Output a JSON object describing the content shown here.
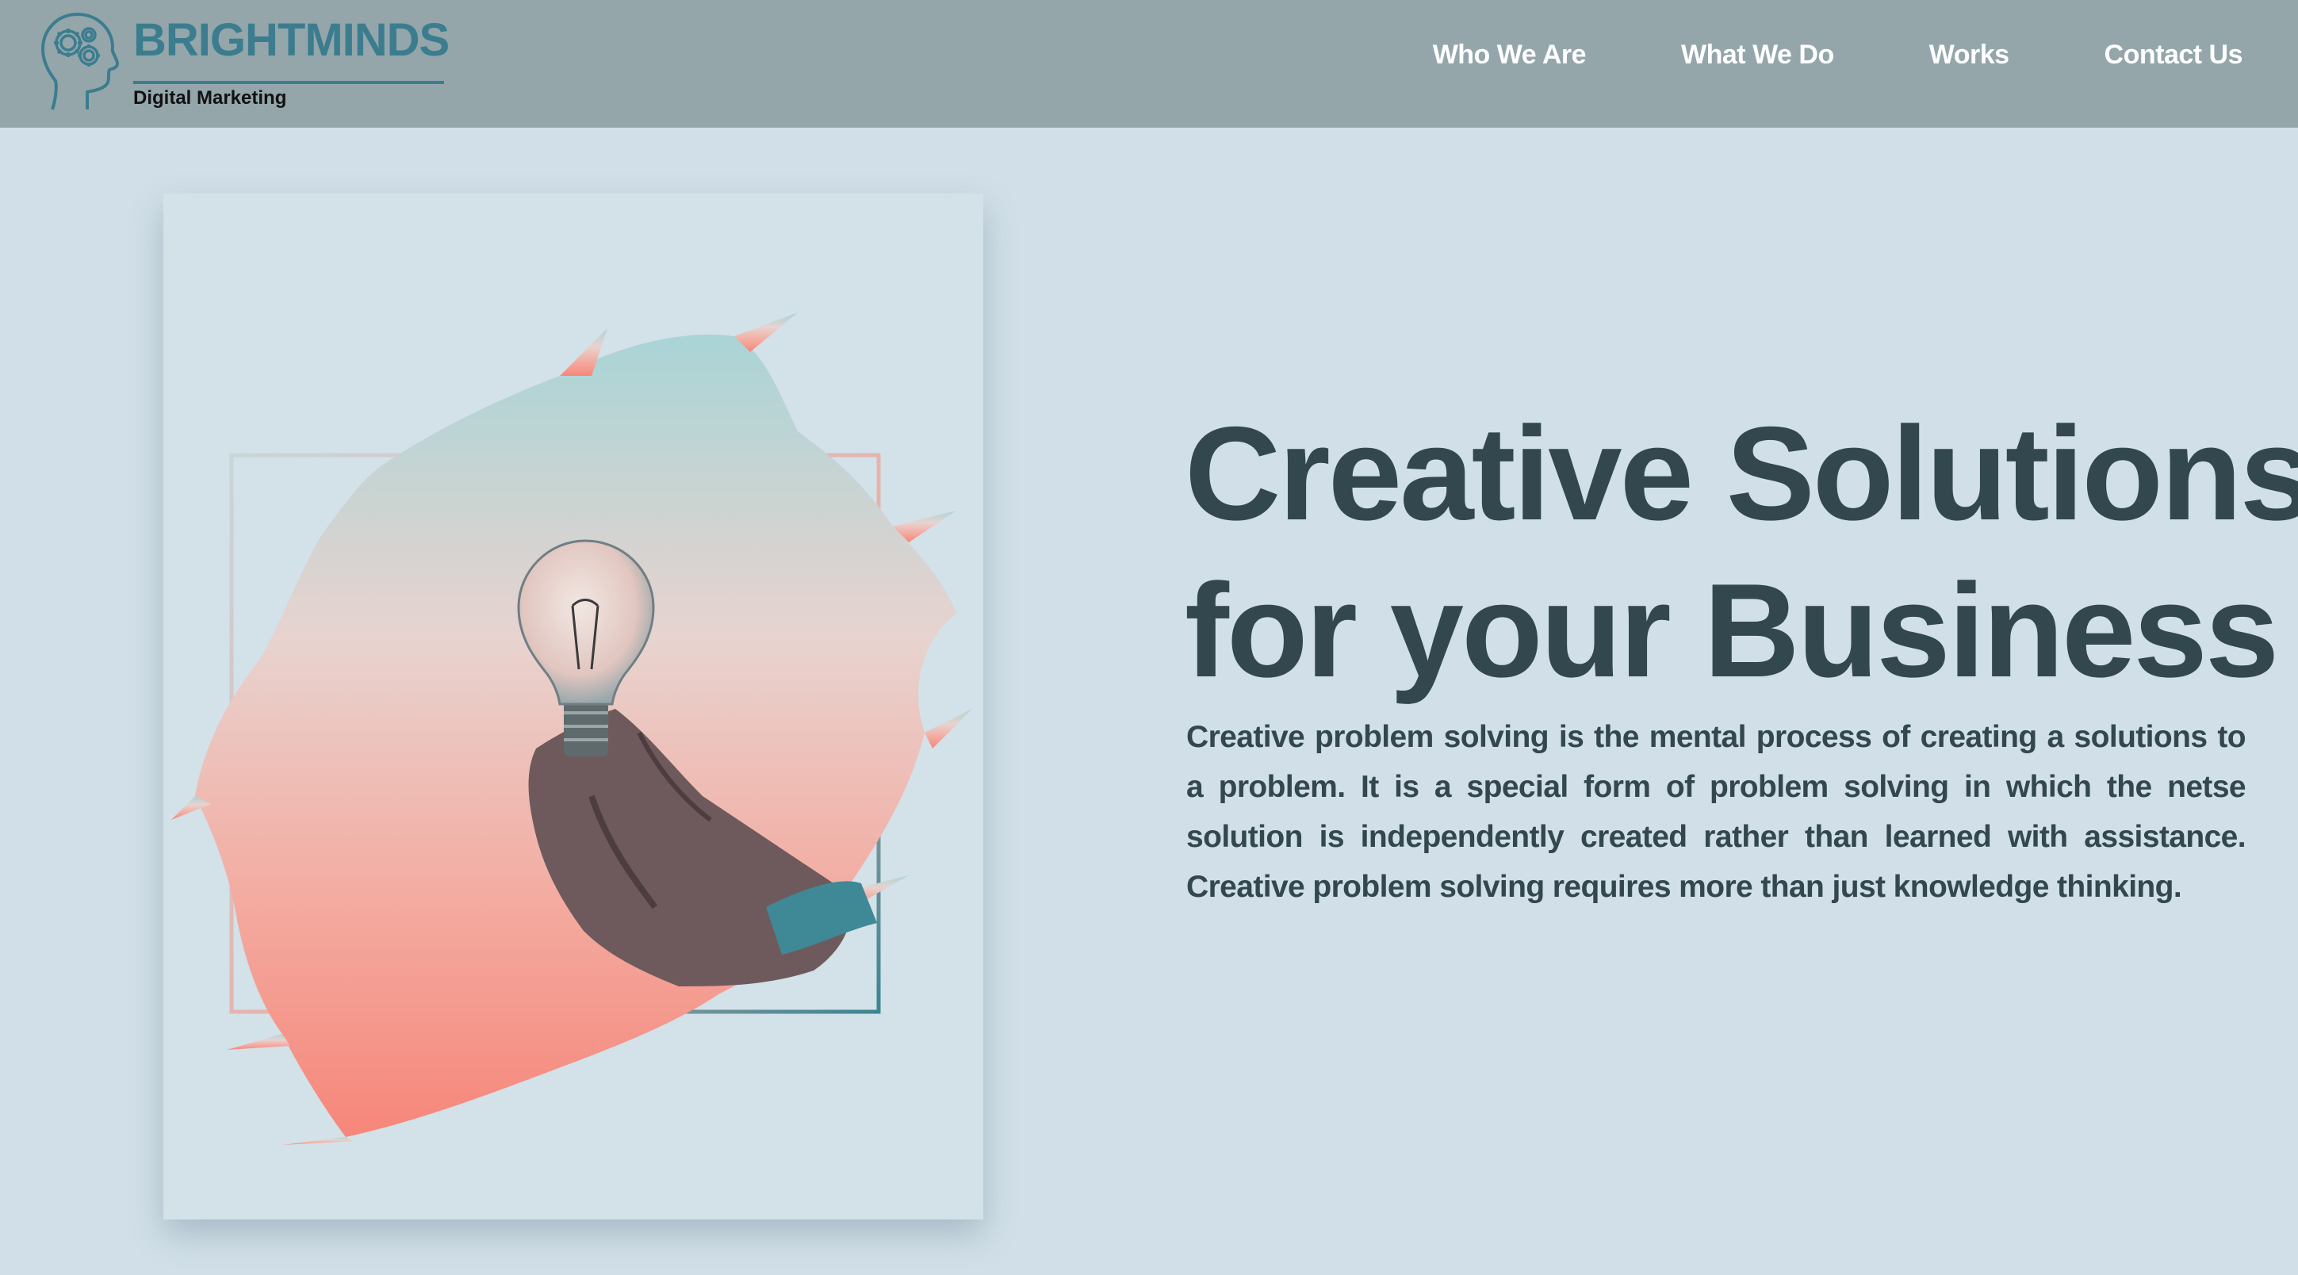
{
  "brand": {
    "name": "BRIGHTMINDS",
    "tagline": "Digital Marketing",
    "icon": "head-gears-icon",
    "color": "#3b7d8f"
  },
  "nav": {
    "items": [
      {
        "label": "Who We Are"
      },
      {
        "label": "What We Do"
      },
      {
        "label": "Works"
      },
      {
        "label": "Contact Us"
      }
    ]
  },
  "hero": {
    "image": "lightbulb-in-hand-icon",
    "headline_line1": "Creative Solutions",
    "headline_line2": "for your Business",
    "body": "Creative problem solving is the mental process of creating a solutions to a problem. It is a special form of problem solving in which the netse solution is independently created rather than learned with assistance. Creative problem solving requires more than just knowledge thinking."
  },
  "colors": {
    "header_bg": "#94a6aa",
    "page_bg": "#d1e0e8",
    "text": "#33474e",
    "accent_teal": "#3b7d8f",
    "accent_coral": "#f28b7e"
  }
}
